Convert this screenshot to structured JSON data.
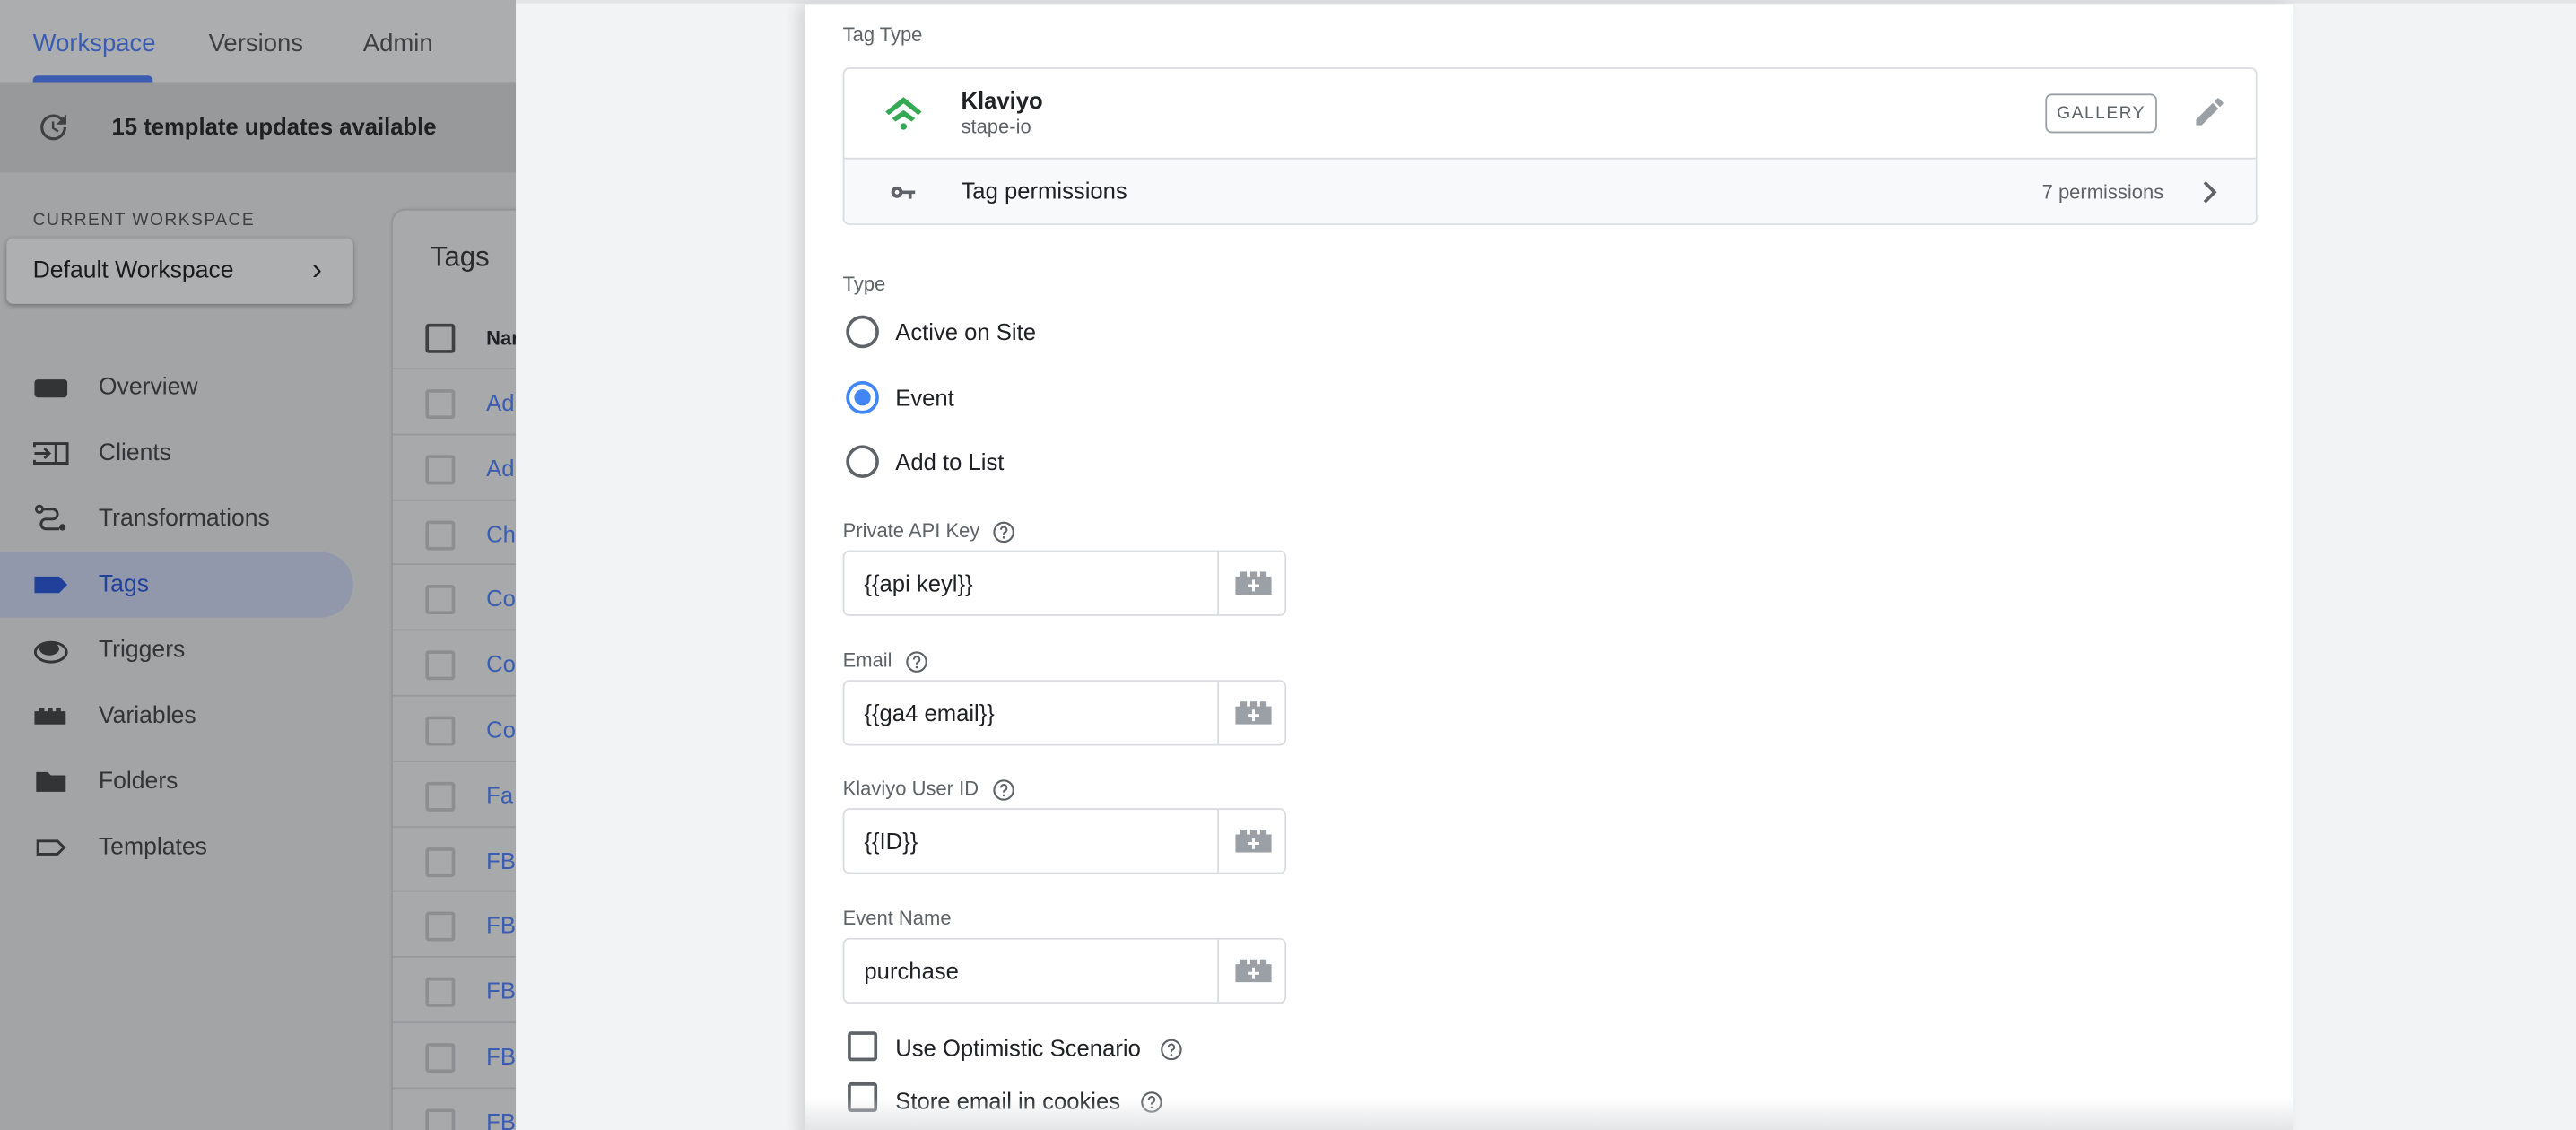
{
  "topnav": {
    "tabs": [
      {
        "label": "Workspace",
        "active": true
      },
      {
        "label": "Versions"
      },
      {
        "label": "Admin"
      }
    ]
  },
  "banner": {
    "text": "15 template updates available",
    "icon": "update-clock-icon"
  },
  "workspace": {
    "label": "CURRENT WORKSPACE",
    "name": "Default Workspace"
  },
  "sidebar": {
    "items": [
      {
        "label": "Overview",
        "icon": "overview-icon"
      },
      {
        "label": "Clients",
        "icon": "clients-icon"
      },
      {
        "label": "Transformations",
        "icon": "transformations-icon"
      },
      {
        "label": "Tags",
        "icon": "tag-icon",
        "active": true
      },
      {
        "label": "Triggers",
        "icon": "triggers-icon"
      },
      {
        "label": "Variables",
        "icon": "variables-icon"
      },
      {
        "label": "Folders",
        "icon": "folder-icon"
      },
      {
        "label": "Templates",
        "icon": "template-icon"
      }
    ]
  },
  "tags_list": {
    "title": "Tags",
    "header": "Nar",
    "rows": [
      "Ad",
      "Ad",
      "Ch",
      "Co",
      "Co",
      "Co",
      "Fa",
      "FB",
      "FB",
      "FB",
      "FB",
      "FB"
    ]
  },
  "tag_type": {
    "label": "Tag Type",
    "name": "Klaviyo",
    "publisher": "stape-io",
    "gallery_label": "GALLERY",
    "permissions_label": "Tag permissions",
    "permissions_count": "7 permissions",
    "brand_color": "#34a853"
  },
  "type": {
    "label": "Type",
    "options": [
      {
        "label": "Active on Site",
        "selected": false
      },
      {
        "label": "Event",
        "selected": true
      },
      {
        "label": "Add to List",
        "selected": false
      }
    ]
  },
  "fields": [
    {
      "label": "Private API Key",
      "value": "{{api keyl}}",
      "help": true
    },
    {
      "label": "Email",
      "value": "{{ga4 email}}",
      "help": true
    },
    {
      "label": "Klaviyo User ID",
      "value": "{{ID}}",
      "help": true
    },
    {
      "label": "Event Name",
      "value": "purchase",
      "help": false
    }
  ],
  "checkboxes": [
    {
      "label": "Use Optimistic Scenario",
      "checked": false
    },
    {
      "label": "Store email in cookies",
      "checked": false
    }
  ],
  "colors": {
    "accent": "#4285f4",
    "link": "#1a73e8"
  }
}
